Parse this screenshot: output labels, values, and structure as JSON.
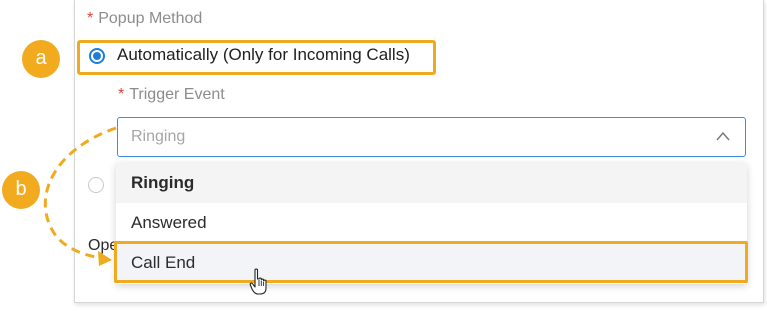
{
  "popup_method": {
    "required_mark": "*",
    "label": "Popup Method",
    "option_auto_label": "Automatically (Only for Incoming Calls)"
  },
  "trigger_event": {
    "required_mark": "*",
    "label": "Trigger Event",
    "selected_value": "Ringing",
    "options": [
      {
        "label": "Ringing",
        "state": "selected"
      },
      {
        "label": "Answered",
        "state": "normal"
      },
      {
        "label": "Call End",
        "state": "hover"
      }
    ]
  },
  "partial_text": "Ope",
  "callouts": {
    "a": "a",
    "b": "b"
  },
  "icons": {
    "select_toggle": "chevron-up-icon",
    "pointer": "hand-cursor-icon"
  },
  "colors": {
    "accent": "#1f7fd6",
    "callout": "#f2aa1f",
    "required": "#e0443a"
  }
}
